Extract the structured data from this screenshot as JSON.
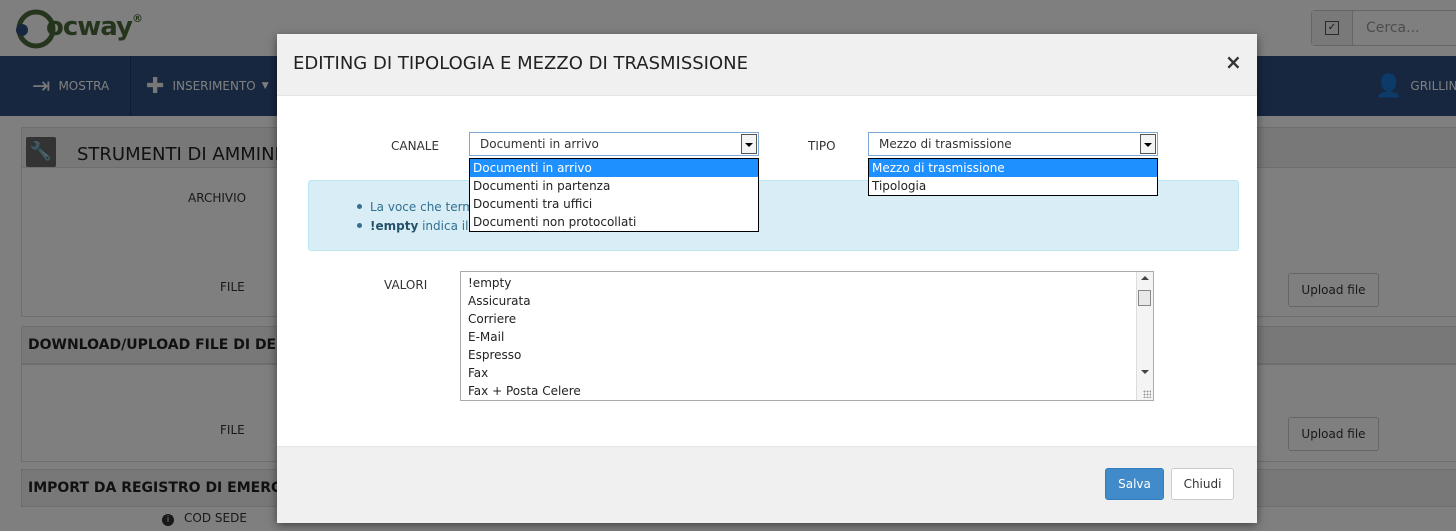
{
  "app": {
    "logo_text": "ocway",
    "logo_reg": "®",
    "search_placeholder": "Cerca..."
  },
  "navbar": {
    "items": [
      {
        "label": "MOSTRA",
        "icon": "sign-in-icon"
      },
      {
        "label": "INSERIMENTO",
        "icon": "plus-icon"
      }
    ],
    "user_label": "GRILLIN"
  },
  "page": {
    "section_title": "STRUMENTI DI AMMINI",
    "archivio_label": "ARCHIVIO",
    "file_label_1": "FILE",
    "upload_button_1": "Upload file",
    "download_section_title": "DOWNLOAD/UPLOAD FILE DI DESCR",
    "file_label_2": "FILE",
    "upload_button_2": "Upload file",
    "import_section_title": "IMPORT DA REGISTRO DI EMERGENZ",
    "cod_sede_label": "COD SEDE"
  },
  "modal": {
    "title": "EDITING DI TIPOLOGIA E MEZZO DI TRASMISSIONE",
    "close_symbol": "×",
    "canale": {
      "label": "CANALE",
      "selected": "Documenti in arrivo",
      "options": [
        "Documenti in arrivo",
        "Documenti in partenza",
        "Documenti tra uffici",
        "Documenti non protocollati"
      ]
    },
    "tipo": {
      "label": "TIPO",
      "selected": "Mezzo di trasmissione",
      "options": [
        "Mezzo di trasmissione",
        "Tipologia"
      ]
    },
    "info": {
      "line1": "La voce che term",
      "line2_bold": "!empty",
      "line2_rest": " indica il v"
    },
    "valori": {
      "label": "VALORI",
      "items": [
        "!empty",
        "Assicurata",
        "Corriere",
        "E-Mail",
        "Espresso",
        "Fax",
        "Fax + Posta Celere"
      ]
    },
    "save_label": "Salva",
    "close_label": "Chiudi"
  },
  "colors": {
    "navbar": "#2c4e7e",
    "primary": "#428bca",
    "info_bg": "#d9edf7",
    "selected_option": "#1e90ff"
  }
}
